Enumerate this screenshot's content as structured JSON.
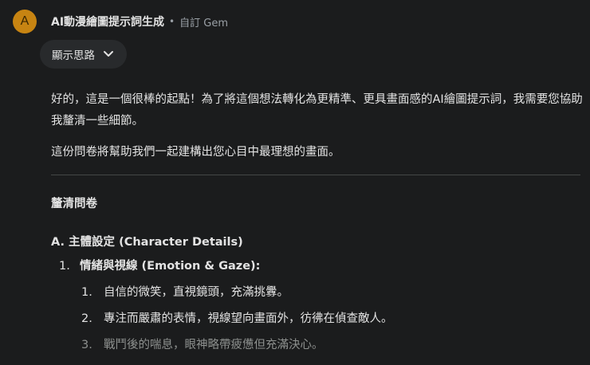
{
  "header": {
    "avatar_letter": "A",
    "gem_name": "AI動漫繪圖提示詞生成",
    "separator": "•",
    "gem_type": "自訂 Gem"
  },
  "thoughts": {
    "label": "顯示思路",
    "icon": "chevron-down-icon"
  },
  "message": {
    "paragraph1": "好的，這是一個很棒的起點！為了將這個想法轉化為更精準、更具畫面感的AI繪圖提示詞，我需要您協助我釐清一些細節。",
    "paragraph2": "這份問卷將幫助我們一起建構出您心目中最理想的畫面。",
    "section_title": "釐清問卷",
    "subsection_title": "A. 主體設定 (Character Details)",
    "list": [
      {
        "num": "1.",
        "label": "情緒與視線 (Emotion & Gaze):",
        "items": [
          {
            "num": "1.",
            "text": "自信的微笑，直視鏡頭，充滿挑釁。"
          },
          {
            "num": "2.",
            "text": "專注而嚴肅的表情，視線望向畫面外，彷彿在偵查敵人。"
          },
          {
            "num": "3.",
            "text": "戰鬥後的喘息，眼神略帶疲憊但充滿決心。"
          }
        ]
      }
    ]
  },
  "colors": {
    "background": "#1b1c1d",
    "avatar": "#c78412",
    "chip": "#282a2c",
    "text": "#e3e3e3",
    "muted": "#9aa0a6"
  }
}
